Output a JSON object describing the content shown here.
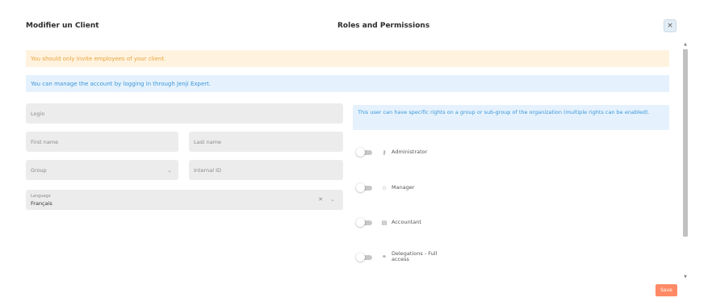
{
  "header": {
    "title_left": "Modifier un Client",
    "title_right": "Roles and Permissions",
    "close_glyph": "×"
  },
  "alerts": {
    "warning": "You should only invite employees of your client.",
    "info": "You can manage the account by logging in through Jenji Expert."
  },
  "form": {
    "login_placeholder": "Login",
    "first_name_placeholder": "First name",
    "last_name_placeholder": "Last name",
    "group_placeholder": "Group",
    "internal_id_placeholder": "Internal ID",
    "language_label": "Language",
    "language_value": "Français"
  },
  "permissions": {
    "info": "This user can have specific rights on a group or sub-group of the organization (multiple rights can be enabled).",
    "roles": [
      {
        "label": "Administrator",
        "icon": "key-icon",
        "enabled": false
      },
      {
        "label": "Manager",
        "icon": "star-icon",
        "enabled": false
      },
      {
        "label": "Accountant",
        "icon": "calculator-icon",
        "enabled": false
      },
      {
        "label": "Delegations - Full access",
        "icon": "handshake-icon",
        "enabled": false
      }
    ]
  },
  "footer": {
    "save_label": "Save"
  },
  "colors": {
    "warning_bg": "#fff3e0",
    "warning_text": "#e8a33a",
    "info_bg": "#e5f2fd",
    "info_text": "#3d96d9",
    "save_bg": "#ff8a65"
  }
}
